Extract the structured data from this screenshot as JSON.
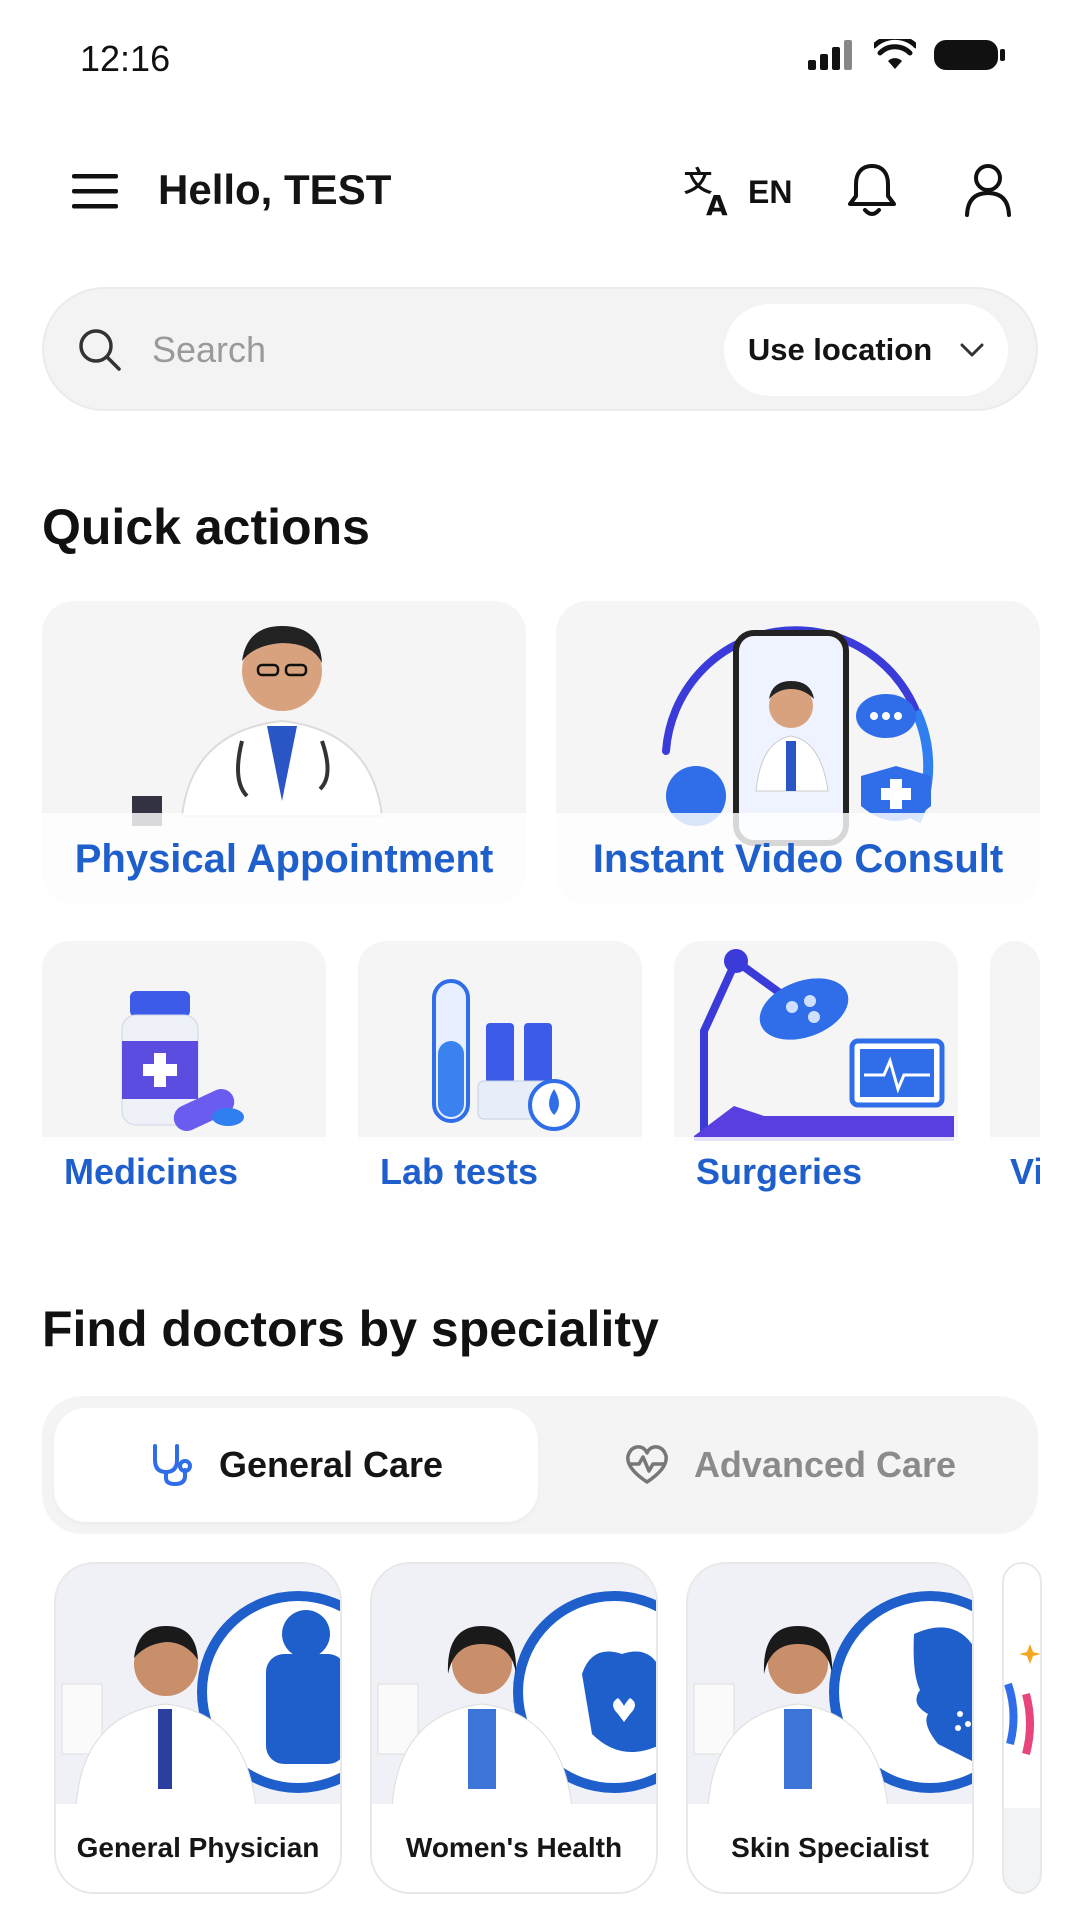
{
  "status_bar": {
    "time": "12:16"
  },
  "header": {
    "greeting": "Hello, TEST",
    "language": "EN"
  },
  "search": {
    "placeholder": "Search",
    "location_button": "Use location"
  },
  "quick_actions": {
    "title": "Quick actions",
    "primary": [
      {
        "label": "Physical Appointment",
        "icon": "doctor-illustration"
      },
      {
        "label": "Instant Video Consult",
        "icon": "video-call-illustration"
      }
    ],
    "secondary": [
      {
        "label": "Medicines",
        "icon": "medicine-bottle-illustration"
      },
      {
        "label": "Lab tests",
        "icon": "test-tube-illustration"
      },
      {
        "label": "Surgeries",
        "icon": "surgery-lamp-illustration"
      },
      {
        "label": "Vi",
        "icon": "partial-card"
      }
    ]
  },
  "speciality": {
    "title": "Find doctors by speciality",
    "tabs": [
      {
        "label": "General Care",
        "icon": "stethoscope-icon",
        "selected": true
      },
      {
        "label": "Advanced Care",
        "icon": "heart-pulse-icon",
        "selected": false
      }
    ],
    "cards": [
      {
        "label": "General Physician"
      },
      {
        "label": "Women's Health"
      },
      {
        "label": "Skin Specialist"
      }
    ]
  },
  "colors": {
    "accent_blue": "#1f5fcc",
    "card_bg": "#f5f5f5"
  }
}
